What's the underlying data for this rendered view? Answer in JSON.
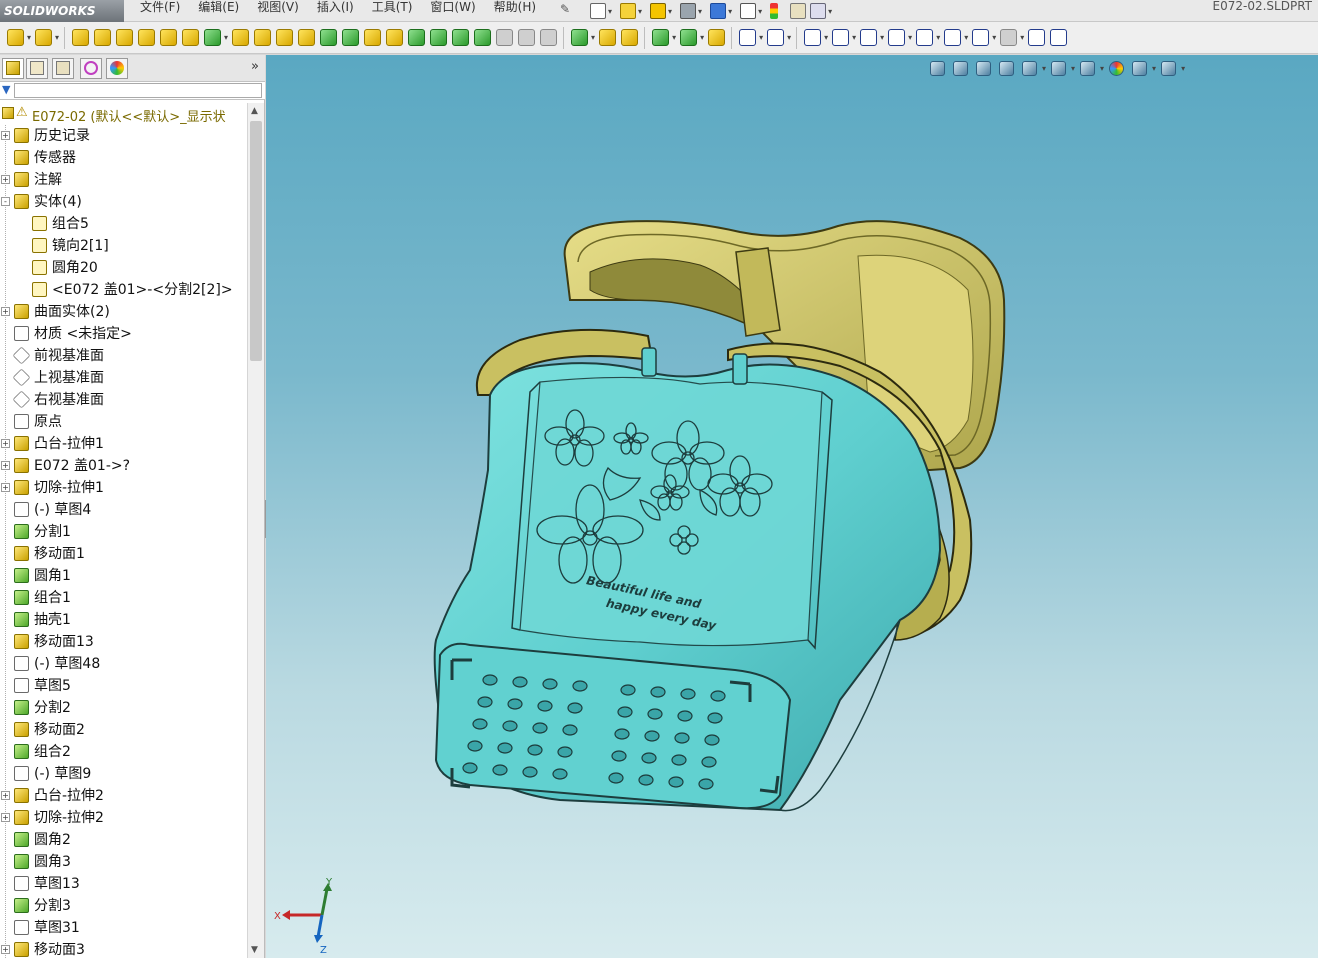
{
  "app": {
    "logo_text": "SOLIDWORKS",
    "document_title": "E072-02.SLDPRT"
  },
  "menus": [
    "文件(F)",
    "编辑(E)",
    "视图(V)",
    "插入(I)",
    "工具(T)",
    "窗口(W)",
    "帮助(H)"
  ],
  "panel": {
    "expand_glyph": "»",
    "filter_icon": "funnel-icon",
    "root_label": "E072-02  (默认<<默认>_显示状"
  },
  "tree": {
    "items": [
      {
        "label": "历史记录",
        "icon": "history-icon",
        "indent": 0,
        "expander": "+"
      },
      {
        "label": "传感器",
        "icon": "sensor-icon",
        "indent": 0,
        "expander": ""
      },
      {
        "label": "注解",
        "icon": "annotation-icon",
        "indent": 0,
        "expander": "+"
      },
      {
        "label": "实体(4)",
        "icon": "solid-bodies-icon",
        "indent": 0,
        "expander": "-"
      },
      {
        "label": "组合5",
        "icon": "body-icon",
        "indent": 1,
        "expander": ""
      },
      {
        "label": "镜向2[1]",
        "icon": "body-icon",
        "indent": 1,
        "expander": ""
      },
      {
        "label": "圆角20",
        "icon": "body-icon",
        "indent": 1,
        "expander": ""
      },
      {
        "label": "<E072 盖01>-<分割2[2]>",
        "icon": "body-icon",
        "indent": 1,
        "expander": ""
      },
      {
        "label": "曲面实体(2)",
        "icon": "surface-bodies-icon",
        "indent": 0,
        "expander": "+"
      },
      {
        "label": "材质 <未指定>",
        "icon": "material-icon",
        "indent": 0,
        "expander": ""
      },
      {
        "label": "前视基准面",
        "icon": "plane-icon",
        "indent": 0,
        "expander": ""
      },
      {
        "label": "上视基准面",
        "icon": "plane-icon",
        "indent": 0,
        "expander": ""
      },
      {
        "label": "右视基准面",
        "icon": "plane-icon",
        "indent": 0,
        "expander": ""
      },
      {
        "label": "原点",
        "icon": "origin-icon",
        "indent": 0,
        "expander": ""
      },
      {
        "label": "凸台-拉伸1",
        "icon": "boss-extrude-icon",
        "indent": 0,
        "expander": "+"
      },
      {
        "label": "E072 盖01->?",
        "icon": "part-reference-icon",
        "indent": 0,
        "expander": "+"
      },
      {
        "label": "切除-拉伸1",
        "icon": "cut-extrude-icon",
        "indent": 0,
        "expander": "+"
      },
      {
        "label": "(-) 草图4",
        "icon": "sketch-icon",
        "indent": 0,
        "expander": ""
      },
      {
        "label": "分割1",
        "icon": "split-icon",
        "indent": 0,
        "expander": ""
      },
      {
        "label": "移动面1",
        "icon": "move-face-icon",
        "indent": 0,
        "expander": ""
      },
      {
        "label": "圆角1",
        "icon": "fillet-icon",
        "indent": 0,
        "expander": ""
      },
      {
        "label": "组合1",
        "icon": "combine-icon",
        "indent": 0,
        "expander": ""
      },
      {
        "label": "抽壳1",
        "icon": "shell-icon",
        "indent": 0,
        "expander": ""
      },
      {
        "label": "移动面13",
        "icon": "move-face-icon",
        "indent": 0,
        "expander": ""
      },
      {
        "label": "(-) 草图48",
        "icon": "sketch-icon",
        "indent": 0,
        "expander": ""
      },
      {
        "label": "草图5",
        "icon": "sketch-icon",
        "indent": 0,
        "expander": ""
      },
      {
        "label": "分割2",
        "icon": "split-icon",
        "indent": 0,
        "expander": ""
      },
      {
        "label": "移动面2",
        "icon": "move-face-icon",
        "indent": 0,
        "expander": ""
      },
      {
        "label": "组合2",
        "icon": "combine-icon",
        "indent": 0,
        "expander": ""
      },
      {
        "label": "(-) 草图9",
        "icon": "sketch-icon",
        "indent": 0,
        "expander": ""
      },
      {
        "label": "凸台-拉伸2",
        "icon": "boss-extrude-icon",
        "indent": 0,
        "expander": "+"
      },
      {
        "label": "切除-拉伸2",
        "icon": "cut-extrude-icon",
        "indent": 0,
        "expander": "+"
      },
      {
        "label": "圆角2",
        "icon": "fillet-icon",
        "indent": 0,
        "expander": ""
      },
      {
        "label": "圆角3",
        "icon": "fillet-icon",
        "indent": 0,
        "expander": ""
      },
      {
        "label": "草图13",
        "icon": "sketch-icon",
        "indent": 0,
        "expander": ""
      },
      {
        "label": "分割3",
        "icon": "split-icon",
        "indent": 0,
        "expander": ""
      },
      {
        "label": "草图31",
        "icon": "sketch-icon",
        "indent": 0,
        "expander": ""
      },
      {
        "label": "移动面3",
        "icon": "move-face-icon",
        "indent": 0,
        "expander": "+"
      }
    ]
  },
  "model": {
    "engraving_line1": "Beautiful life and",
    "engraving_line2": "happy every day",
    "colors": {
      "basket": "#5fcfcf",
      "lid": "#cfc668",
      "lid_dark": "#8f8a3a",
      "edge": "#1d3d3d"
    }
  },
  "triad": {
    "x": "X",
    "y": "Y",
    "z": "Z"
  }
}
